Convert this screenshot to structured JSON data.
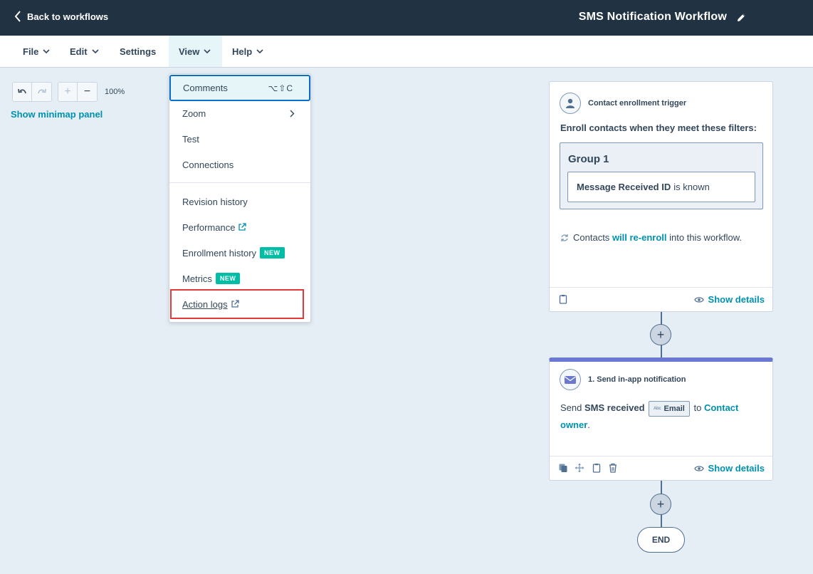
{
  "topbar": {
    "back_label": "Back to workflows",
    "workflow_title": "SMS Notification Workflow"
  },
  "menubar": {
    "items": [
      {
        "label": "File"
      },
      {
        "label": "Edit"
      },
      {
        "label": "Settings"
      },
      {
        "label": "View"
      },
      {
        "label": "Help"
      }
    ],
    "active": "View"
  },
  "canvas": {
    "zoom_level": "100%",
    "minimap_label": "Show minimap panel"
  },
  "view_menu": {
    "items": [
      {
        "label": "Comments",
        "shortcut": "⌥⇧C"
      },
      {
        "label": "Zoom"
      },
      {
        "label": "Test"
      },
      {
        "label": "Connections"
      },
      {
        "label": "Revision history"
      },
      {
        "label": "Performance"
      },
      {
        "label": "Enrollment history",
        "badge": "NEW"
      },
      {
        "label": "Metrics",
        "badge": "NEW"
      },
      {
        "label": "Action logs"
      }
    ]
  },
  "trigger_card": {
    "header": "Contact enrollment trigger",
    "enroll_text": "Enroll contacts when they meet these filters:",
    "group_title": "Group 1",
    "filter_property": "Message Received ID",
    "filter_condition": "is known",
    "reenroll_prefix": "Contacts",
    "reenroll_link": "will re-enroll",
    "reenroll_suffix": "into this workflow.",
    "show_details": "Show details"
  },
  "action_card": {
    "header": "1. Send in-app notification",
    "send_prefix": "Send",
    "send_bold": "SMS received",
    "token_tag": "Abc",
    "token_label": "Email",
    "to_text": "to",
    "recipient_link": "Contact owner",
    "period": ".",
    "show_details": "Show details"
  },
  "end_label": "END",
  "colors": {
    "topbar_bg": "#213343",
    "accent_link": "#0091ae",
    "badge_bg": "#00bda5",
    "action_card_accent": "#6a78d1",
    "highlight_red": "#e53935",
    "focus_blue": "#0b6ec9"
  }
}
